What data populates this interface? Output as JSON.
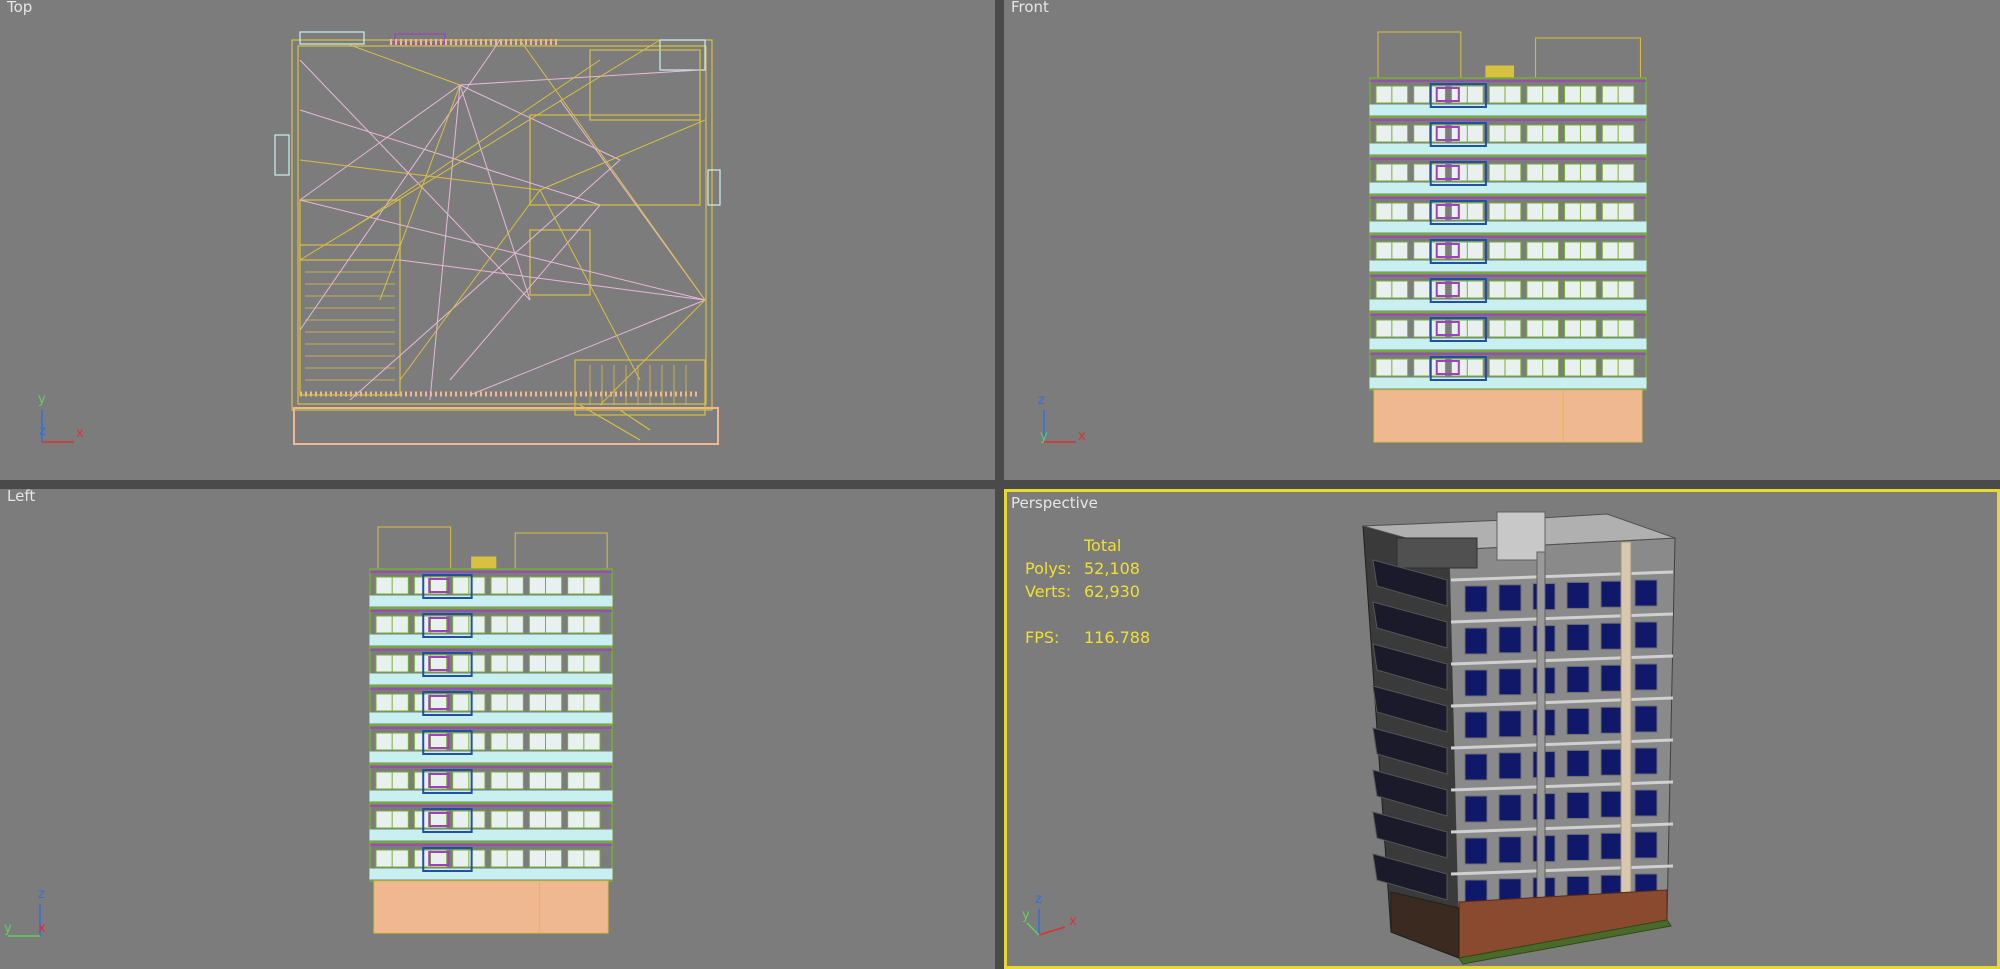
{
  "viewports": {
    "top": {
      "label": "Top",
      "axis": {
        "a": "y",
        "b": "z",
        "c": "x"
      }
    },
    "front": {
      "label": "Front",
      "axis": {
        "a": "z",
        "b": "y",
        "c": "x"
      }
    },
    "left": {
      "label": "Left",
      "axis": {
        "a": "z",
        "b": "y",
        "c": "x"
      }
    },
    "perspective": {
      "label": "Perspective",
      "axis": {
        "a": "z",
        "b": "y",
        "c": "x"
      }
    }
  },
  "stats": {
    "header": "Total",
    "polys_label": "Polys:",
    "polys_value": "52,108",
    "verts_label": "Verts:",
    "verts_value": "62,930",
    "fps_label": "FPS:",
    "fps_value": "116.788"
  },
  "colors": {
    "viewport_bg": "#7c7c7c",
    "active_border": "#e8d832",
    "stats_text": "#f0e030",
    "wire_yellow": "#d8c040",
    "wire_pink": "#e8b8d8",
    "wire_green": "#78b030",
    "wire_cyan": "#c8f0f0",
    "wire_peach": "#f0b890",
    "wire_purple": "#a040c0",
    "wire_blue": "#2050a0"
  },
  "icons": [
    "axis-tripod-icon"
  ]
}
